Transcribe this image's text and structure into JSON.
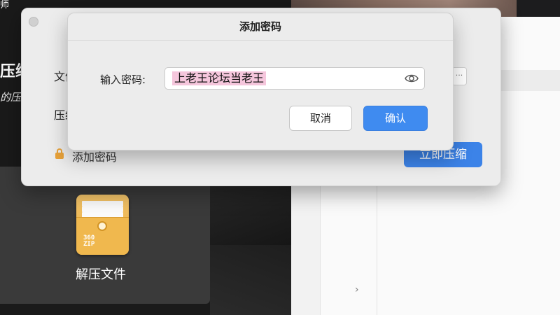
{
  "background": {
    "corner_text": "师",
    "big_title": "压缩",
    "script_text": "的压",
    "zip_icon": {
      "name": "360zip-archive-icon",
      "brand_line1": "360",
      "brand_line2": "ZIP"
    },
    "zip_label": "解压文件",
    "chevron": "›"
  },
  "main_window": {
    "file_label": "文件",
    "format_label": "压缩",
    "more_button": "···",
    "add_password": "添加密码",
    "compress_button": "立即压缩"
  },
  "dialog": {
    "title": "添加密码",
    "password_label": "输入密码:",
    "password_value": "上老王论坛当老王",
    "cancel_label": "取消",
    "ok_label": "确认"
  },
  "colors": {
    "accent_blue": "#3f8bf0",
    "selection_pink": "#f5c6dc",
    "lock_orange": "#e8a23a"
  }
}
